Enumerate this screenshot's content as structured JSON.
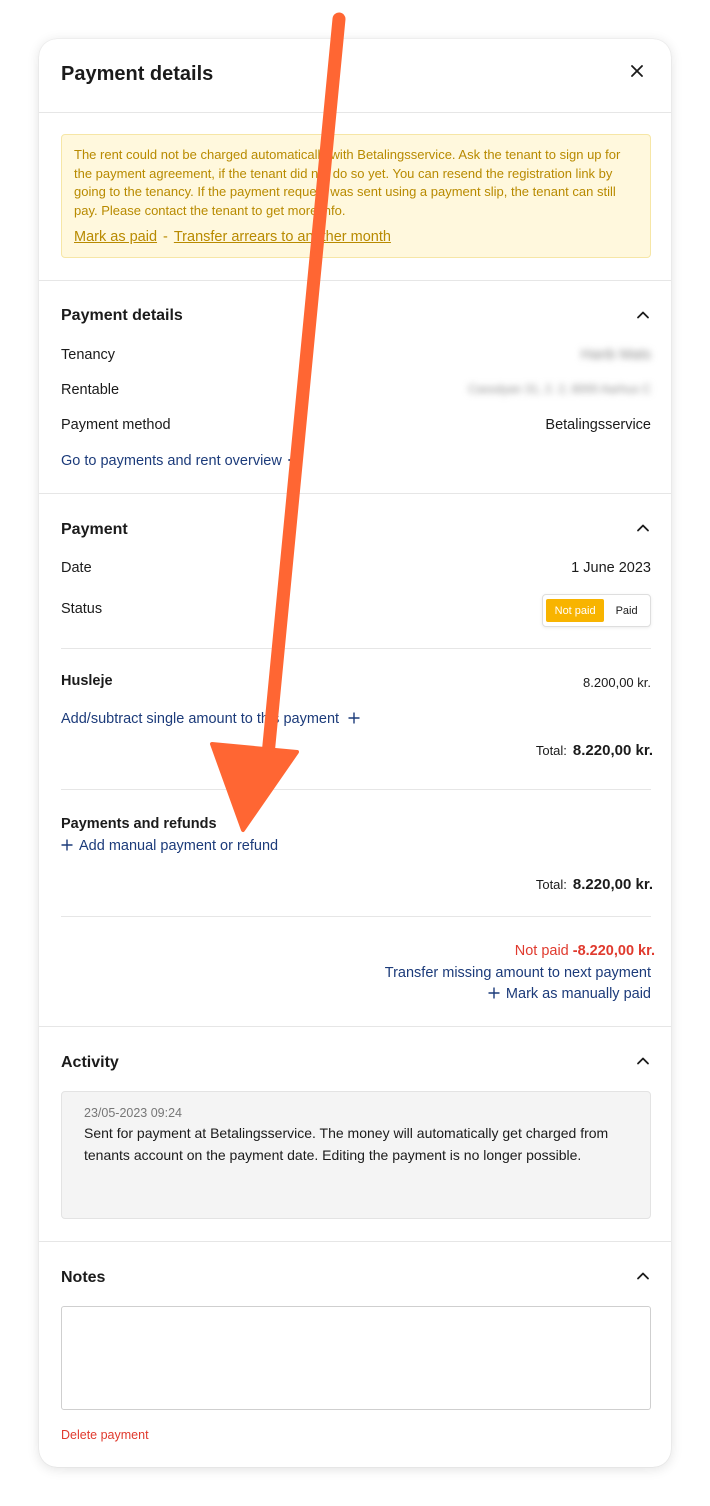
{
  "header": {
    "title": "Payment details"
  },
  "alert": {
    "message": "The rent could not be charged automatically with Betalingsservice. Ask the tenant to sign up for the payment agreement, if the tenant did not do so yet. You can resend the registration link by going to the tenancy. If the payment request was sent using a payment slip, the tenant can still pay. Please contact the tenant to get more info.",
    "mark_as_paid": "Mark as paid",
    "separator": "-",
    "transfer_arrears": "Transfer arrears to another month"
  },
  "details": {
    "title": "Payment details",
    "tenancy_label": "Tenancy",
    "tenancy_value": "Hanb Mats",
    "rentable_label": "Rentable",
    "rentable_value": "Cassdyan 31, 2. 2, 8000 Aarhus C",
    "method_label": "Payment method",
    "method_value": "Betalingsservice",
    "overview_link": "Go to payments and rent overview"
  },
  "payment": {
    "title": "Payment",
    "date_label": "Date",
    "date_value": "1 June 2023",
    "status_label": "Status",
    "status_not_paid": "Not paid",
    "status_paid": "Paid",
    "item_label": "Husleje",
    "item_value": "8.200,00 kr.",
    "add_amount_link": "Add/subtract single amount to this payment",
    "total_label": "Total:",
    "total_value": "8.220,00 kr."
  },
  "refunds": {
    "title": "Payments and refunds",
    "add_link": "Add manual payment or refund",
    "total_label": "Total:",
    "total_value": "8.220,00 kr."
  },
  "balance": {
    "not_paid_label": "Not paid",
    "not_paid_value": "-8.220,00 kr.",
    "transfer_link": "Transfer missing amount to next payment",
    "mark_manual_link": "Mark as manually paid"
  },
  "activity": {
    "title": "Activity",
    "timestamp": "23/05-2023 09:24",
    "text": "Sent for payment at Betalingsservice. The money will automatically get charged from tenants account on the payment date. Editing the payment is no longer possible."
  },
  "notes": {
    "title": "Notes",
    "value": ""
  },
  "footer": {
    "delete_link": "Delete payment"
  },
  "colors": {
    "accent_link": "#1c3b7a",
    "warning_text": "#b88a00",
    "warning_bg": "#fff8dd",
    "danger": "#e03a2e",
    "status_active": "#f8b400",
    "annotation_arrow": "#ff6633"
  }
}
